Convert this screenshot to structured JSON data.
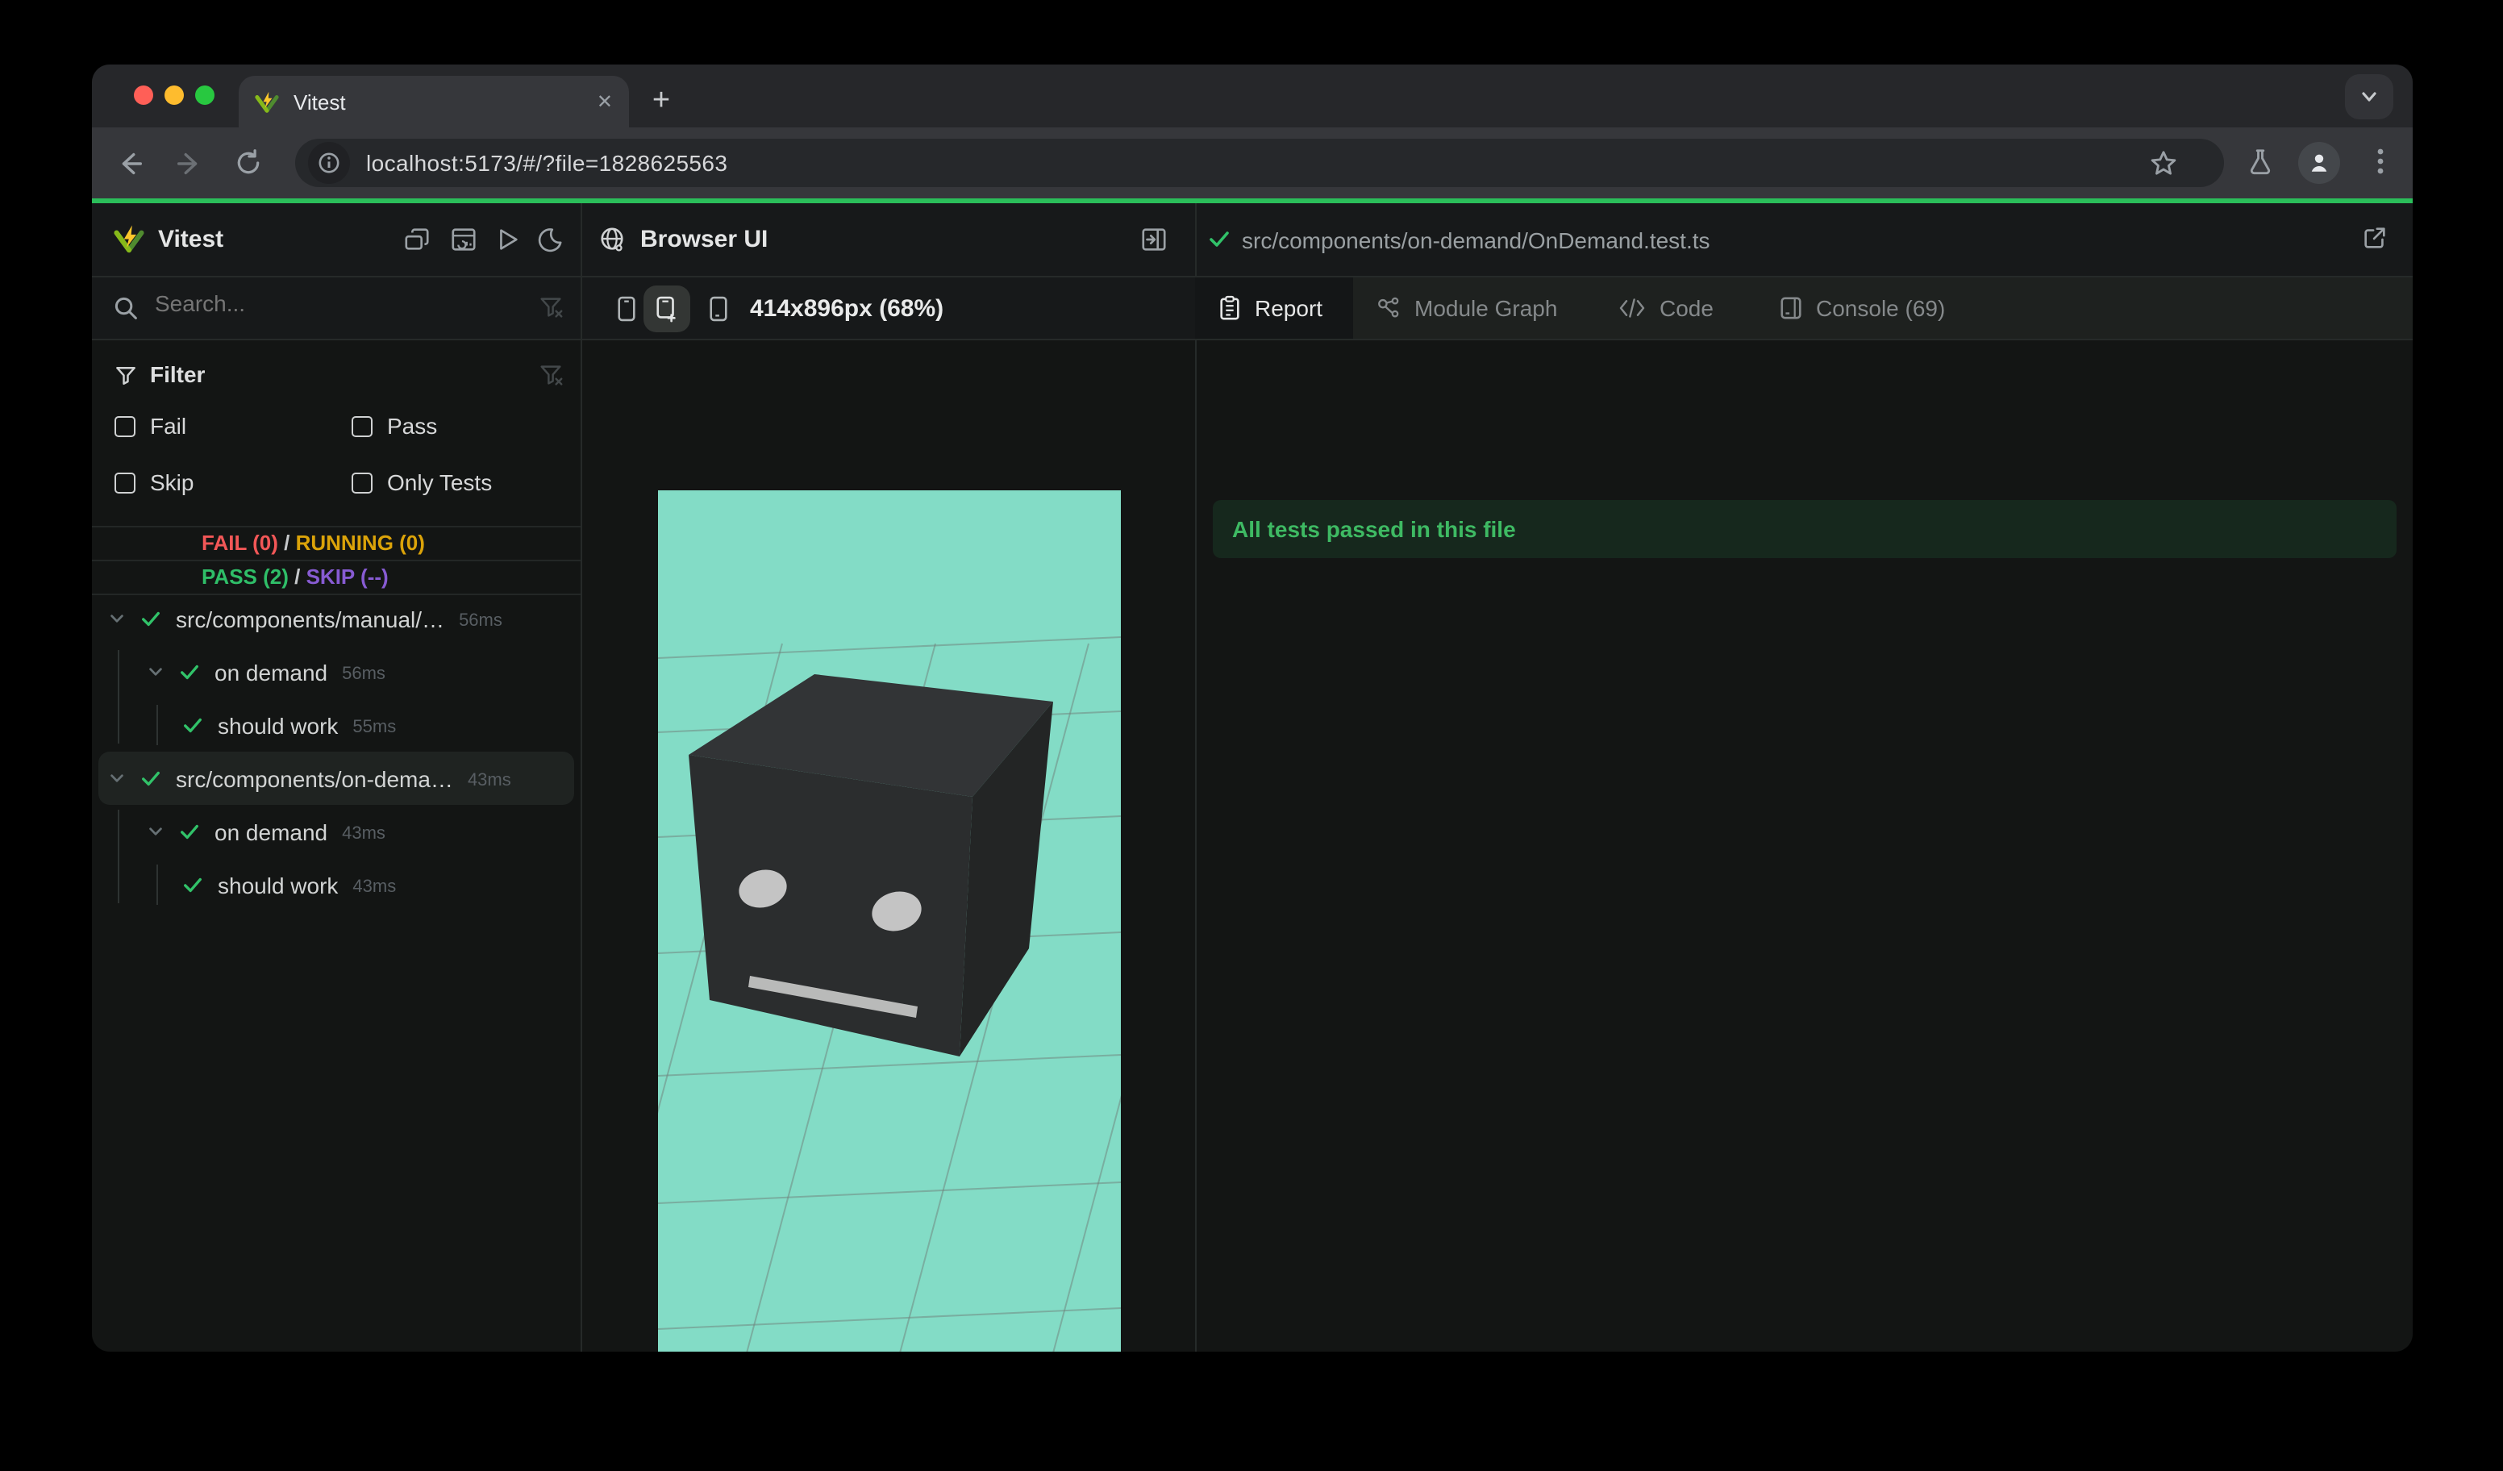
{
  "window": {
    "traffic_lights": [
      "close",
      "minimize",
      "zoom"
    ]
  },
  "browser_chrome": {
    "tab_title": "Vitest",
    "tab_close": "✕",
    "new_tab_button": "+",
    "url": "localhost:5173/#/?file=1828625563",
    "icons": [
      "back-arrow",
      "forward-arrow",
      "reload",
      "site-info",
      "bookmark-star",
      "experiments-flask",
      "profile-avatar",
      "menu-dots",
      "tab-search-chevron"
    ]
  },
  "sidebar": {
    "title": "Vitest",
    "toolbar_icons": [
      "collapse-windows",
      "dashboard-report",
      "run-all-play",
      "dark-mode-moon"
    ],
    "search": {
      "placeholder": "Search..."
    },
    "filter": {
      "title": "Filter",
      "options": [
        {
          "label": "Fail",
          "checked": false
        },
        {
          "label": "Pass",
          "checked": false
        },
        {
          "label": "Skip",
          "checked": false
        },
        {
          "label": "Only Tests",
          "checked": false
        }
      ]
    },
    "summary": {
      "fail": "FAIL (0)",
      "running": "RUNNING (0)",
      "pass": "PASS (2)",
      "skip": "SKIP (--)",
      "separator": "/"
    },
    "tree": [
      {
        "label": "src/components/manual/…",
        "duration": "56ms",
        "level": 0,
        "status": "pass",
        "selected": false
      },
      {
        "label": "on demand",
        "duration": "56ms",
        "level": 1,
        "status": "pass",
        "selected": false
      },
      {
        "label": "should work",
        "duration": "55ms",
        "level": 2,
        "status": "pass",
        "selected": false
      },
      {
        "label": "src/components/on-dema…",
        "duration": "43ms",
        "level": 0,
        "status": "pass",
        "selected": true
      },
      {
        "label": "on demand",
        "duration": "43ms",
        "level": 1,
        "status": "pass",
        "selected": false
      },
      {
        "label": "should work",
        "duration": "43ms",
        "level": 2,
        "status": "pass",
        "selected": false
      }
    ]
  },
  "browser_panel": {
    "title": "Browser UI",
    "viewport_label": "414x896px (68%)",
    "icons": [
      "globe",
      "open-panel-right",
      "device-phone",
      "device-phone-plus",
      "device-phone-minus"
    ]
  },
  "report_panel": {
    "file_path": "src/components/on-demand/OnDemand.test.ts",
    "file_status": "pass",
    "tabs": [
      {
        "label": "Report",
        "active": true,
        "icon": "clipboard"
      },
      {
        "label": "Module Graph",
        "active": false,
        "icon": "graph-nodes"
      },
      {
        "label": "Code",
        "active": false,
        "icon": "code-brackets"
      },
      {
        "label": "Console (69)",
        "active": false,
        "icon": "console-panel"
      }
    ],
    "banner": "All tests passed in this file"
  },
  "colors": {
    "accent_green": "#2bbe5a",
    "fail_red": "#f25757",
    "running_yellow": "#dba309",
    "pass_green": "#2fbe68",
    "skip_purple": "#875bd2",
    "banner_bg": "#16281d",
    "banner_text": "#3eba63",
    "viewport_bg": "#83dcc6",
    "grid_line": "#6f7f7a",
    "cube_top": "#323436",
    "cube_front": "#2b2d2e",
    "cube_right": "#232525",
    "cube_eye": "#c4c4c4",
    "cube_mouth": "#b9bab9"
  }
}
